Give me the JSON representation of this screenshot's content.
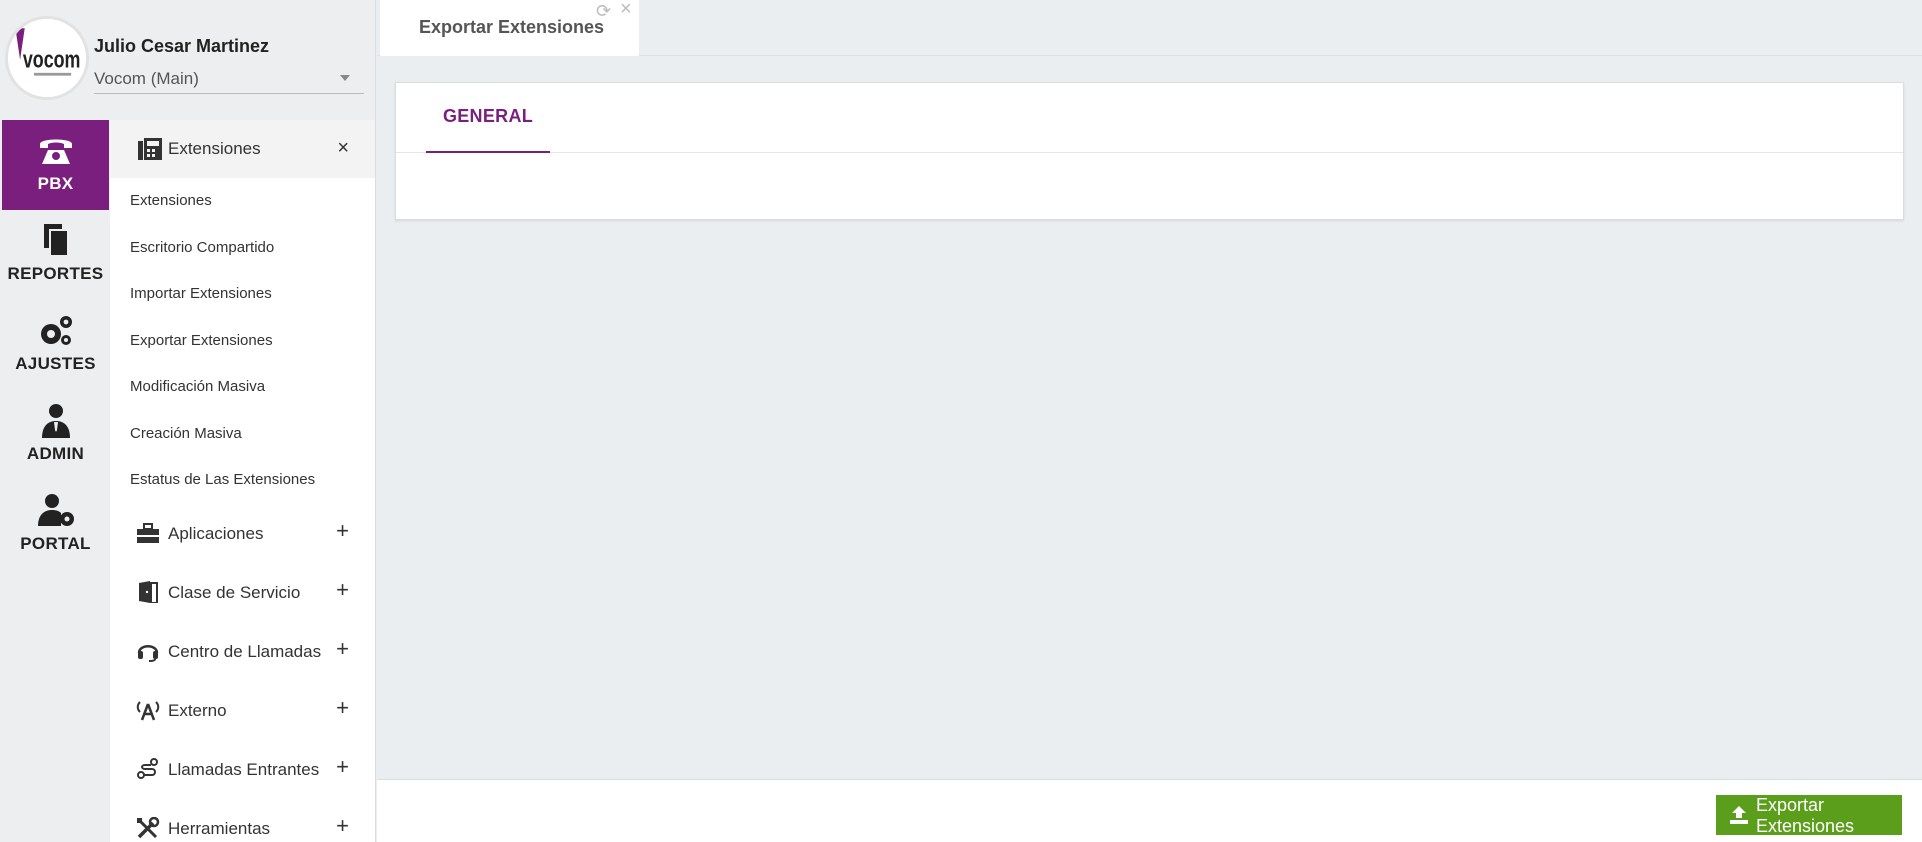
{
  "user": {
    "name": "Julio Cesar Martinez",
    "tenant": "Vocom (Main)",
    "logo_text": "vocom"
  },
  "rail": [
    {
      "label": "PBX",
      "icon": "phone-icon",
      "active": true
    },
    {
      "label": "REPORTES",
      "icon": "documents-icon",
      "active": false
    },
    {
      "label": "AJUSTES",
      "icon": "gears-icon",
      "active": false
    },
    {
      "label": "ADMIN",
      "icon": "user-tie-icon",
      "active": false
    },
    {
      "label": "PORTAL",
      "icon": "user-cog-icon",
      "active": false
    }
  ],
  "submenu": {
    "header": {
      "label": "Extensiones",
      "icon": "fax-icon"
    },
    "links": [
      "Extensiones",
      "Escritorio Compartido",
      "Importar Extensiones",
      "Exportar Extensiones",
      "Modificación Masiva",
      "Creación Masiva",
      "Estatus de Las Extensiones"
    ],
    "groups": [
      {
        "label": "Aplicaciones",
        "icon": "toolbox-icon"
      },
      {
        "label": "Clase de Servicio",
        "icon": "door-icon"
      },
      {
        "label": "Centro de Llamadas",
        "icon": "headset-icon"
      },
      {
        "label": "Externo",
        "icon": "broadcast-icon"
      },
      {
        "label": "Llamadas Entrantes",
        "icon": "route-icon"
      },
      {
        "label": "Herramientas",
        "icon": "tools-icon"
      }
    ]
  },
  "tabs": [
    {
      "label": "Exportar Extensiones"
    }
  ],
  "card": {
    "tab_label": "GENERAL"
  },
  "footer": {
    "export_button_label": "Exportar Extensiones"
  },
  "colors": {
    "brand": "#7b1f7f",
    "success": "#5a9e1b"
  }
}
